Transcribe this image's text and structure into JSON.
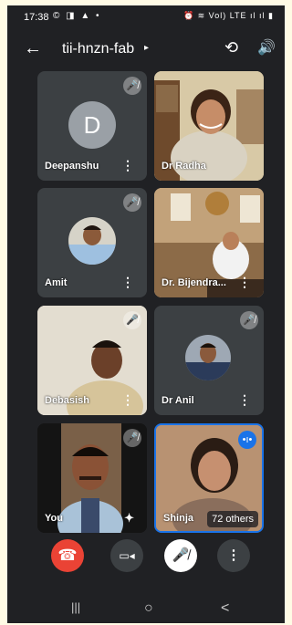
{
  "status": {
    "time": "17:38",
    "left_icons": "© ◨ ▲ •",
    "right_icons": "⏰ ≋ Vol) LTE ıl ıl ▮"
  },
  "header": {
    "title": "tii-hnzn-fab",
    "back_icon": "←",
    "title_chevron": "▸",
    "switch_camera_icon": "⟲",
    "speaker_icon": "🔊"
  },
  "tiles": [
    {
      "name": "Deepanshu",
      "avatar_letter": "D",
      "muted": true
    },
    {
      "name": "Dr Radha",
      "muted": false
    },
    {
      "name": "Amit",
      "muted": true
    },
    {
      "name": "Dr. Bijendra...",
      "muted": false
    },
    {
      "name": "Debasish",
      "muted": true
    },
    {
      "name": "Dr Anil",
      "muted": true
    },
    {
      "name": "You",
      "muted": true
    },
    {
      "name": "Shinja",
      "others": "72 others",
      "speaking": true
    }
  ],
  "icons": {
    "mute": "🎤̸",
    "more": "⋮",
    "effects": "✦"
  },
  "controls": {
    "end_call": "☎",
    "camera": "▭◂",
    "mic": "🎤̸",
    "more": "⋮"
  },
  "navbar": {
    "recent": "|||",
    "home": "○",
    "back": "<"
  },
  "colors": {
    "background": "#202124",
    "tile": "#3c4043",
    "end_call": "#ea4335",
    "active_border": "#1a73e8",
    "outer": "#fffbe5"
  }
}
